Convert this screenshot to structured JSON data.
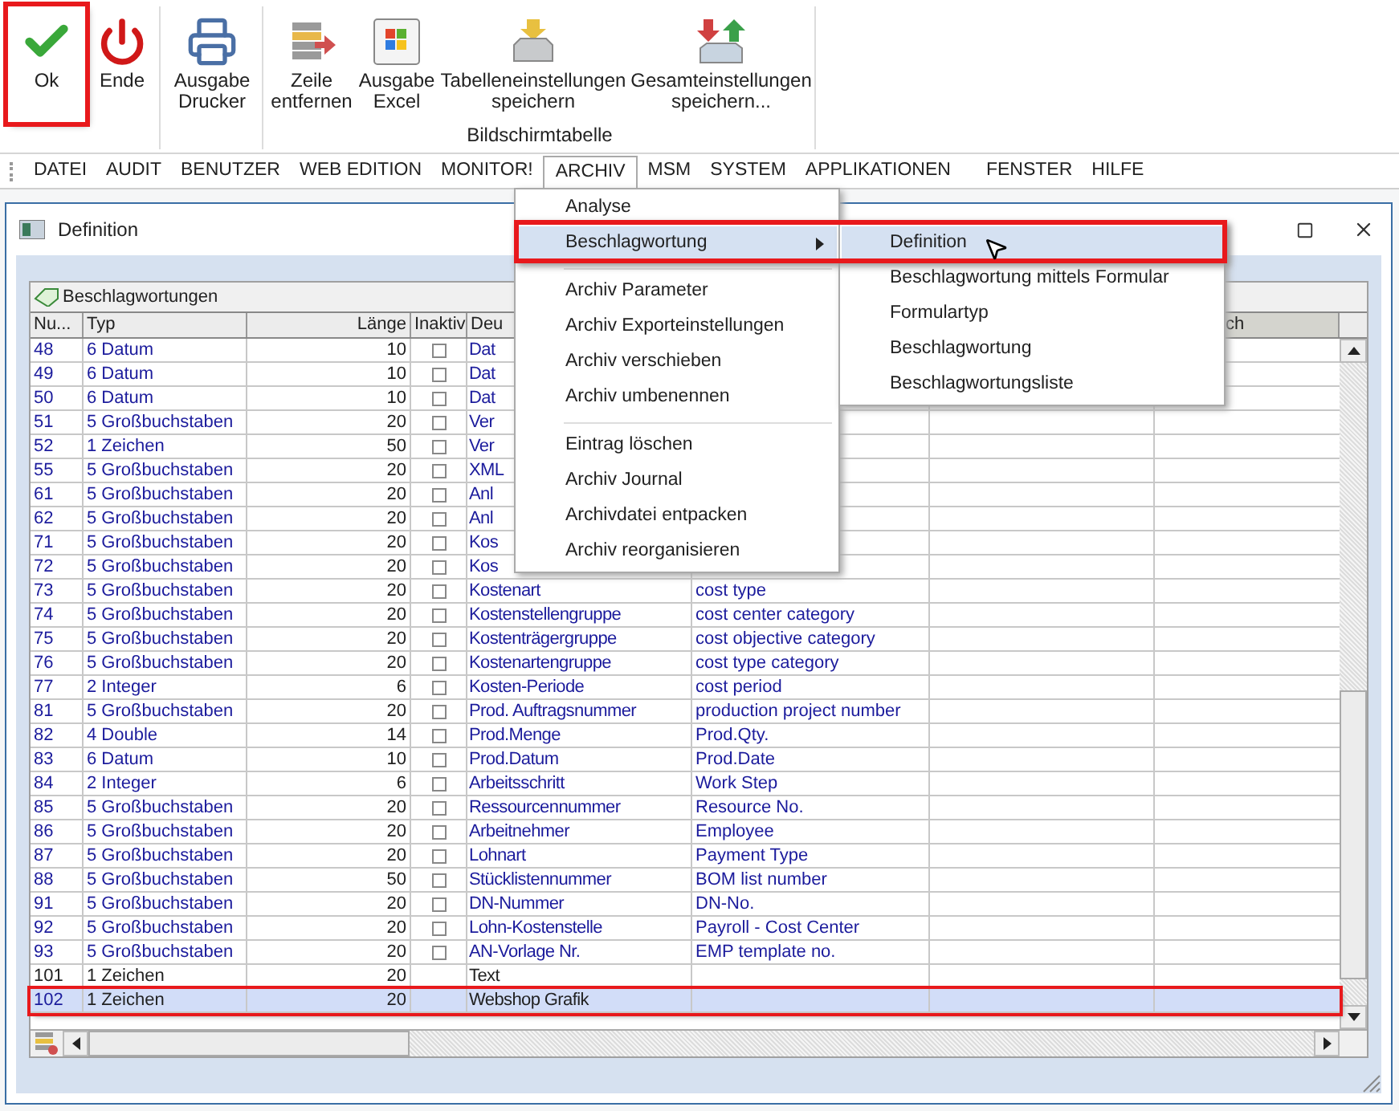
{
  "toolbar": {
    "groups": [
      {
        "buttons": [
          {
            "lines": [
              "Ok"
            ],
            "highlighted": true
          },
          {
            "lines": [
              "Ende"
            ],
            "highlighted": false
          }
        ]
      },
      {
        "buttons": [
          {
            "lines": [
              "Ausgabe",
              "Drucker"
            ],
            "highlighted": false
          }
        ]
      },
      {
        "label": "Bildschirmtabelle",
        "buttons": [
          {
            "lines": [
              "Zeile",
              "entfernen"
            ],
            "highlighted": false
          },
          {
            "lines": [
              "Ausgabe",
              "Excel"
            ],
            "highlighted": false
          },
          {
            "lines": [
              "Tabelleneinstellungen",
              "speichern"
            ],
            "highlighted": false
          },
          {
            "lines": [
              "Gesamteinstellungen",
              "speichern..."
            ],
            "highlighted": false
          }
        ]
      }
    ]
  },
  "menubar": [
    {
      "label": "DATEI",
      "selected": false
    },
    {
      "label": "AUDIT",
      "selected": false
    },
    {
      "label": "BENUTZER",
      "selected": false
    },
    {
      "label": "WEB EDITION",
      "selected": false
    },
    {
      "label": "MONITOR!",
      "selected": false
    },
    {
      "label": "ARCHIV",
      "selected": true
    },
    {
      "label": "MSM",
      "selected": false
    },
    {
      "label": "SYSTEM",
      "selected": false
    },
    {
      "label": "APPLIKATIONEN",
      "selected": false
    },
    {
      "label": "FENSTER",
      "selected": false
    },
    {
      "label": "HILFE",
      "selected": false
    }
  ],
  "menu": [
    {
      "kind": "item",
      "label": "Analyse",
      "selected": false,
      "submenu": false
    },
    {
      "kind": "item",
      "label": "Beschlagwortung",
      "selected": true,
      "submenu": true
    },
    {
      "kind": "separator"
    },
    {
      "kind": "item",
      "label": "Archiv Parameter",
      "selected": false,
      "submenu": false
    },
    {
      "kind": "item",
      "label": "Archiv Exporteinstellungen",
      "selected": false,
      "submenu": false
    },
    {
      "kind": "item",
      "label": "Archiv verschieben",
      "selected": false,
      "submenu": false
    },
    {
      "kind": "item",
      "label": "Archiv umbenennen",
      "selected": false,
      "submenu": false
    },
    {
      "kind": "separator"
    },
    {
      "kind": "item",
      "label": "Eintrag löschen",
      "selected": false,
      "submenu": false
    },
    {
      "kind": "item",
      "label": "Archiv Journal",
      "selected": false,
      "submenu": false
    },
    {
      "kind": "item",
      "label": "Archivdatei entpacken",
      "selected": false,
      "submenu": false
    },
    {
      "kind": "item",
      "label": "Archiv reorganisieren",
      "selected": false,
      "submenu": false
    }
  ],
  "submenu": [
    {
      "label": "Definition",
      "selected": true,
      "highlighted": true
    },
    {
      "label": "Beschlagwortung mittels Formular",
      "selected": false,
      "highlighted": false
    },
    {
      "label": "Formulartyp",
      "selected": false,
      "highlighted": false
    },
    {
      "label": "Beschlagwortung",
      "selected": false,
      "highlighted": false
    },
    {
      "label": "Beschlagwortungsliste",
      "selected": false,
      "highlighted": false
    }
  ],
  "window": {
    "title": "Definition"
  },
  "panel": {
    "title": "Beschlagwortungen"
  },
  "table": {
    "columns": [
      {
        "label": "Nu..."
      },
      {
        "label": "Typ"
      },
      {
        "label": "Länge"
      },
      {
        "label": "Inaktiv"
      },
      {
        "label": "Deu"
      },
      {},
      {},
      {
        "label": "ch"
      }
    ],
    "rows": [
      {
        "nr": "48",
        "typ": "6 Datum",
        "len": "10",
        "checked": false,
        "deu": "Dat",
        "selected": false,
        "highlighted": false
      },
      {
        "nr": "49",
        "typ": "6 Datum",
        "len": "10",
        "checked": false,
        "deu": "Dat",
        "selected": false,
        "highlighted": false
      },
      {
        "nr": "50",
        "typ": "6 Datum",
        "len": "10",
        "checked": false,
        "deu": "Dat",
        "selected": false,
        "highlighted": false
      },
      {
        "nr": "51",
        "typ": "5 Großbuchstaben",
        "len": "20",
        "checked": false,
        "deu": "Ver",
        "selected": false,
        "highlighted": false
      },
      {
        "nr": "52",
        "typ": "1 Zeichen",
        "len": "50",
        "checked": false,
        "deu": "Ver",
        "selected": false,
        "highlighted": false
      },
      {
        "nr": "55",
        "typ": "5 Großbuchstaben",
        "len": "20",
        "checked": false,
        "deu": "XML",
        "selected": false,
        "highlighted": false
      },
      {
        "nr": "61",
        "typ": "5 Großbuchstaben",
        "len": "20",
        "checked": false,
        "deu": "Anl",
        "selected": false,
        "highlighted": false
      },
      {
        "nr": "62",
        "typ": "5 Großbuchstaben",
        "len": "20",
        "checked": false,
        "deu": "Anl",
        "selected": false,
        "highlighted": false
      },
      {
        "nr": "71",
        "typ": "5 Großbuchstaben",
        "len": "20",
        "checked": false,
        "deu": "Kos",
        "selected": false,
        "highlighted": false
      },
      {
        "nr": "72",
        "typ": "5 Großbuchstaben",
        "len": "20",
        "checked": false,
        "deu": "Kos",
        "selected": false,
        "highlighted": false
      },
      {
        "nr": "73",
        "typ": "5 Großbuchstaben",
        "len": "20",
        "checked": false,
        "deu": "Kostenart",
        "en": "cost type",
        "selected": false,
        "highlighted": false
      },
      {
        "nr": "74",
        "typ": "5 Großbuchstaben",
        "len": "20",
        "checked": false,
        "deu": "Kostenstellengruppe",
        "en": "cost center category",
        "selected": false,
        "highlighted": false
      },
      {
        "nr": "75",
        "typ": "5 Großbuchstaben",
        "len": "20",
        "checked": false,
        "deu": "Kostenträgergruppe",
        "en": "cost objective category",
        "selected": false,
        "highlighted": false
      },
      {
        "nr": "76",
        "typ": "5 Großbuchstaben",
        "len": "20",
        "checked": false,
        "deu": "Kostenartengruppe",
        "en": "cost type category",
        "selected": false,
        "highlighted": false
      },
      {
        "nr": "77",
        "typ": "2 Integer",
        "len": "6",
        "checked": false,
        "deu": "Kosten-Periode",
        "en": "cost period",
        "selected": false,
        "highlighted": false
      },
      {
        "nr": "81",
        "typ": "5 Großbuchstaben",
        "len": "20",
        "checked": false,
        "deu": "Prod. Auftragsnummer",
        "en": "production project number",
        "selected": false,
        "highlighted": false
      },
      {
        "nr": "82",
        "typ": "4 Double",
        "len": "14",
        "checked": false,
        "deu": "Prod.Menge",
        "en": "Prod.Qty.",
        "selected": false,
        "highlighted": false
      },
      {
        "nr": "83",
        "typ": "6 Datum",
        "len": "10",
        "checked": false,
        "deu": "Prod.Datum",
        "en": "Prod.Date",
        "selected": false,
        "highlighted": false
      },
      {
        "nr": "84",
        "typ": "2 Integer",
        "len": "6",
        "checked": false,
        "deu": "Arbeitsschritt",
        "en": "Work Step",
        "selected": false,
        "highlighted": false
      },
      {
        "nr": "85",
        "typ": "5 Großbuchstaben",
        "len": "20",
        "checked": false,
        "deu": "Ressourcennummer",
        "en": "Resource No.",
        "selected": false,
        "highlighted": false
      },
      {
        "nr": "86",
        "typ": "5 Großbuchstaben",
        "len": "20",
        "checked": false,
        "deu": "Arbeitnehmer",
        "en": "Employee",
        "selected": false,
        "highlighted": false
      },
      {
        "nr": "87",
        "typ": "5 Großbuchstaben",
        "len": "20",
        "checked": false,
        "deu": "Lohnart",
        "en": "Payment Type",
        "selected": false,
        "highlighted": false
      },
      {
        "nr": "88",
        "typ": "5 Großbuchstaben",
        "len": "50",
        "checked": false,
        "deu": "Stücklistennummer",
        "en": "BOM list number",
        "selected": false,
        "highlighted": false
      },
      {
        "nr": "91",
        "typ": "5 Großbuchstaben",
        "len": "20",
        "checked": false,
        "deu": "DN-Nummer",
        "en": "DN-No.",
        "selected": false,
        "highlighted": false
      },
      {
        "nr": "92",
        "typ": "5 Großbuchstaben",
        "len": "20",
        "checked": false,
        "deu": "Lohn-Kostenstelle",
        "en": "Payroll - Cost Center",
        "selected": false,
        "highlighted": false
      },
      {
        "nr": "93",
        "typ": "5 Großbuchstaben",
        "len": "20",
        "checked": false,
        "deu": "AN-Vorlage Nr.",
        "en": "EMP template no.",
        "selected": false,
        "highlighted": false
      },
      {
        "nr": "101",
        "typ": "1 Zeichen",
        "len": "20",
        "deu": "Text",
        "selected": false,
        "highlighted": false
      },
      {
        "nr": "102",
        "typ": "1 Zeichen",
        "len": "20",
        "deu": "Webshop Grafik",
        "selected": true,
        "highlighted": true
      }
    ]
  }
}
